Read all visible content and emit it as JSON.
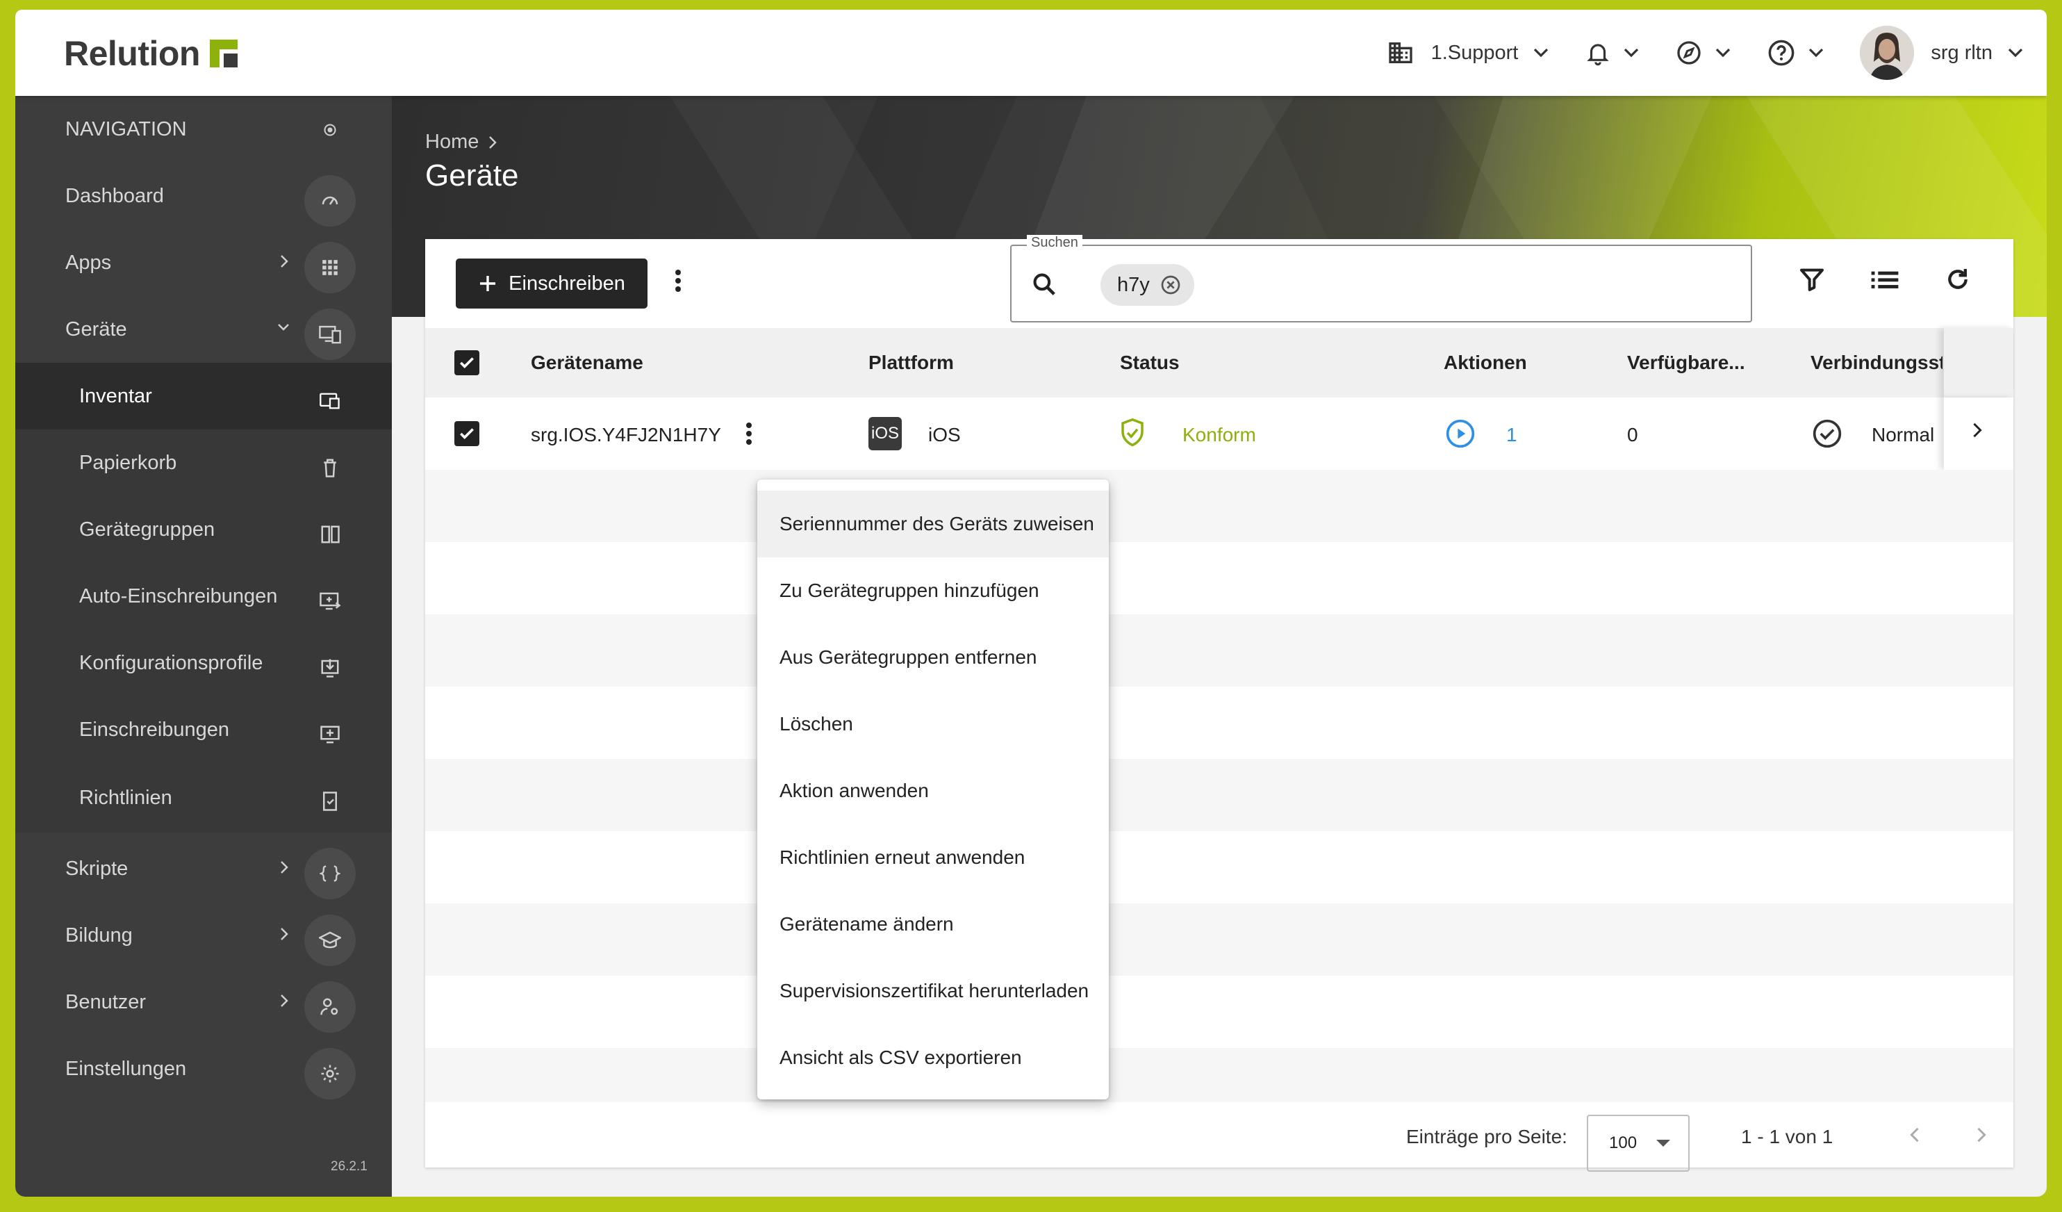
{
  "brand": {
    "name": "Relution"
  },
  "topbar": {
    "organization": "1.Support",
    "user": "srg rltn"
  },
  "sidebar": {
    "section_title": "NAVIGATION",
    "version": "26.2.1",
    "items": [
      {
        "label": "Dashboard",
        "icon": "gauge-icon"
      },
      {
        "label": "Apps",
        "icon": "grid-icon"
      },
      {
        "label": "Geräte",
        "icon": "devices-icon"
      },
      {
        "label": "Inventar",
        "icon": "inventory-icon"
      },
      {
        "label": "Papierkorb",
        "icon": "trash-icon"
      },
      {
        "label": "Gerätegruppen",
        "icon": "device-group-icon"
      },
      {
        "label": "Auto-Einschreibungen",
        "icon": "auto-enroll-icon"
      },
      {
        "label": "Konfigurationsprofile",
        "icon": "profile-download-icon"
      },
      {
        "label": "Einschreibungen",
        "icon": "enroll-icon"
      },
      {
        "label": "Richtlinien",
        "icon": "policy-icon"
      },
      {
        "label": "Skripte",
        "icon": "braces-icon"
      },
      {
        "label": "Bildung",
        "icon": "graduation-cap-icon"
      },
      {
        "label": "Benutzer",
        "icon": "user-settings-icon"
      },
      {
        "label": "Einstellungen",
        "icon": "gear-icon"
      }
    ]
  },
  "page": {
    "breadcrumb": "Home",
    "title": "Geräte"
  },
  "toolbar": {
    "enroll_label": "Einschreiben",
    "search_legend": "Suchen",
    "search_chip": "h7y"
  },
  "table": {
    "headers": [
      "Gerätename",
      "Plattform",
      "Status",
      "Aktionen",
      "Verfügbare...",
      "Verbindungsst"
    ],
    "rows": [
      {
        "name": "srg.IOS.Y4FJ2N1H7Y",
        "platform_badge": "iOS",
        "platform": "iOS",
        "status": "Konform",
        "actions": "1",
        "available": "0",
        "connection": "Normal"
      }
    ]
  },
  "pagination": {
    "per_page_label": "Einträge pro Seite:",
    "per_page_value": "100",
    "range": "1 - 1 von 1"
  },
  "context_menu": {
    "items": [
      "Seriennummer des Geräts zuweisen",
      "Zu Gerätegruppen hinzufügen",
      "Aus Gerätegruppen entfernen",
      "Löschen",
      "Aktion anwenden",
      "Richtlinien erneut anwenden",
      "Gerätename ändern",
      "Supervisionszertifikat herunterladen",
      "Ansicht als CSV exportieren"
    ]
  },
  "colors": {
    "accent_green": "#8fb10b",
    "status_green": "#8cb00c",
    "link_blue": "#2f8fe0",
    "sidebar_bg": "#3d3d3d",
    "frame": "#b5c814"
  }
}
